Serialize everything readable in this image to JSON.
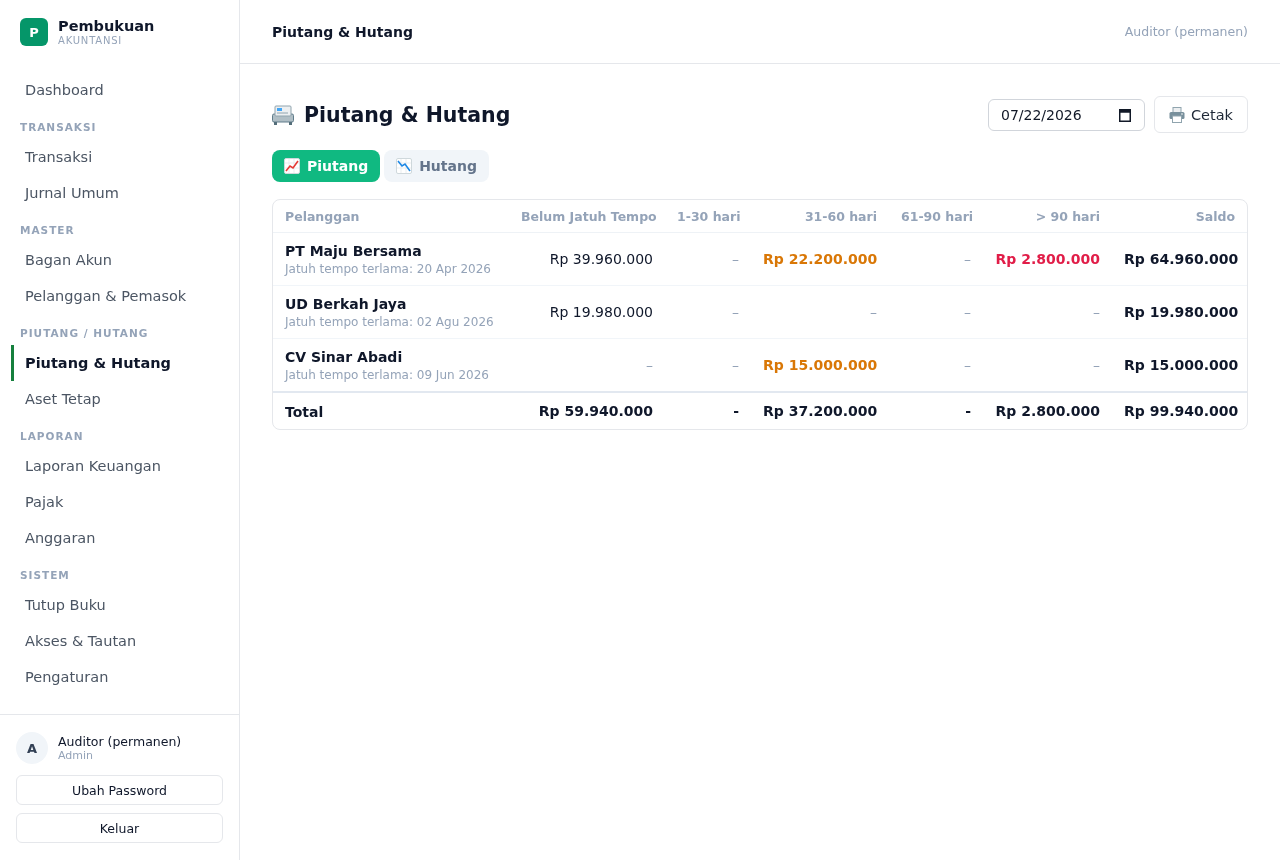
{
  "sidebar": {
    "brand": {
      "logo_letter": "P",
      "name": "Pembukuan",
      "tagline": "AKUNTANSI"
    },
    "nav": [
      {
        "items": [
          {
            "label": "Dashboard",
            "selected": false
          }
        ]
      },
      {
        "heading": "TRANSAKSI",
        "items": [
          {
            "label": "Transaksi",
            "selected": false
          },
          {
            "label": "Jurnal Umum",
            "selected": false
          }
        ]
      },
      {
        "heading": "MASTER",
        "items": [
          {
            "label": "Bagan Akun",
            "selected": false
          },
          {
            "label": "Pelanggan & Pemasok",
            "selected": false
          }
        ]
      },
      {
        "heading": "PIUTANG / HUTANG",
        "items": [
          {
            "label": "Piutang & Hutang",
            "selected": true
          },
          {
            "label": "Aset Tetap",
            "selected": false
          }
        ]
      },
      {
        "heading": "LAPORAN",
        "items": [
          {
            "label": "Laporan Keuangan",
            "selected": false
          },
          {
            "label": "Pajak",
            "selected": false
          },
          {
            "label": "Anggaran",
            "selected": false
          }
        ]
      },
      {
        "heading": "SISTEM",
        "items": [
          {
            "label": "Tutup Buku",
            "selected": false
          },
          {
            "label": "Akses & Tautan",
            "selected": false
          },
          {
            "label": "Pengaturan",
            "selected": false
          }
        ]
      }
    ],
    "user": {
      "avatar_letter": "A",
      "name": "Auditor (permanen)",
      "role": "Admin"
    },
    "buttons": [
      "Ubah Password",
      "Keluar"
    ]
  },
  "header": {
    "title": "Piutang & Hutang",
    "user": "Auditor (permanen)"
  },
  "page": {
    "title": "Piutang & Hutang",
    "date": "07/22/2026",
    "print_button": "Cetak",
    "tabs": [
      {
        "label": "Piutang",
        "selected": true
      },
      {
        "label": "Hutang",
        "selected": false
      }
    ],
    "table": {
      "columns": [
        {
          "label": "Pelanggan",
          "kind": "text"
        },
        {
          "label": "Belum Jatuh Tempo",
          "kind": "amount"
        },
        {
          "label": "1-30 hari",
          "kind": "amount"
        },
        {
          "label": "31-60 hari",
          "kind": "amount"
        },
        {
          "label": "61-90 hari",
          "kind": "amount"
        },
        {
          "label": "> 90 hari",
          "kind": "amount"
        },
        {
          "label": "Saldo",
          "kind": "amount"
        }
      ],
      "rows": [
        {
          "cells": [
            {
              "kind": "customer",
              "text": "PT Maju Bersama",
              "note": "Jatuh tempo terlama: 20 Apr 2026"
            },
            {
              "text": "Rp 39.960.000",
              "kind": "plain"
            },
            {
              "text": "–",
              "kind": "empty"
            },
            {
              "text": "Rp 22.200.000",
              "kind": "warning"
            },
            {
              "text": "–",
              "kind": "empty"
            },
            {
              "text": "Rp 2.800.000",
              "kind": "danger"
            },
            {
              "text": "Rp 64.960.000",
              "kind": "strong"
            }
          ]
        },
        {
          "cells": [
            {
              "kind": "customer",
              "text": "UD Berkah Jaya",
              "note": "Jatuh tempo terlama: 02 Agu 2026"
            },
            {
              "text": "Rp 19.980.000",
              "kind": "plain"
            },
            {
              "text": "–",
              "kind": "empty"
            },
            {
              "text": "–",
              "kind": "empty"
            },
            {
              "text": "–",
              "kind": "empty"
            },
            {
              "text": "–",
              "kind": "empty"
            },
            {
              "text": "Rp 19.980.000",
              "kind": "strong"
            }
          ]
        },
        {
          "cells": [
            {
              "kind": "customer",
              "text": "CV Sinar Abadi",
              "note": "Jatuh tempo terlama: 09 Jun 2026"
            },
            {
              "text": "–",
              "kind": "empty"
            },
            {
              "text": "–",
              "kind": "empty"
            },
            {
              "text": "Rp 15.000.000",
              "kind": "warning"
            },
            {
              "text": "–",
              "kind": "empty"
            },
            {
              "text": "–",
              "kind": "empty"
            },
            {
              "text": "Rp 15.000.000",
              "kind": "strong"
            }
          ]
        }
      ],
      "total": {
        "cells": [
          {
            "text": "Total",
            "kind": "label"
          },
          {
            "text": "Rp 59.940.000",
            "kind": "strong"
          },
          {
            "text": "-",
            "kind": "strong"
          },
          {
            "text": "Rp 37.200.000",
            "kind": "strong"
          },
          {
            "text": "-",
            "kind": "strong"
          },
          {
            "text": "Rp 2.800.000",
            "kind": "strong"
          },
          {
            "text": "Rp 99.940.000",
            "kind": "strong"
          }
        ]
      }
    }
  }
}
